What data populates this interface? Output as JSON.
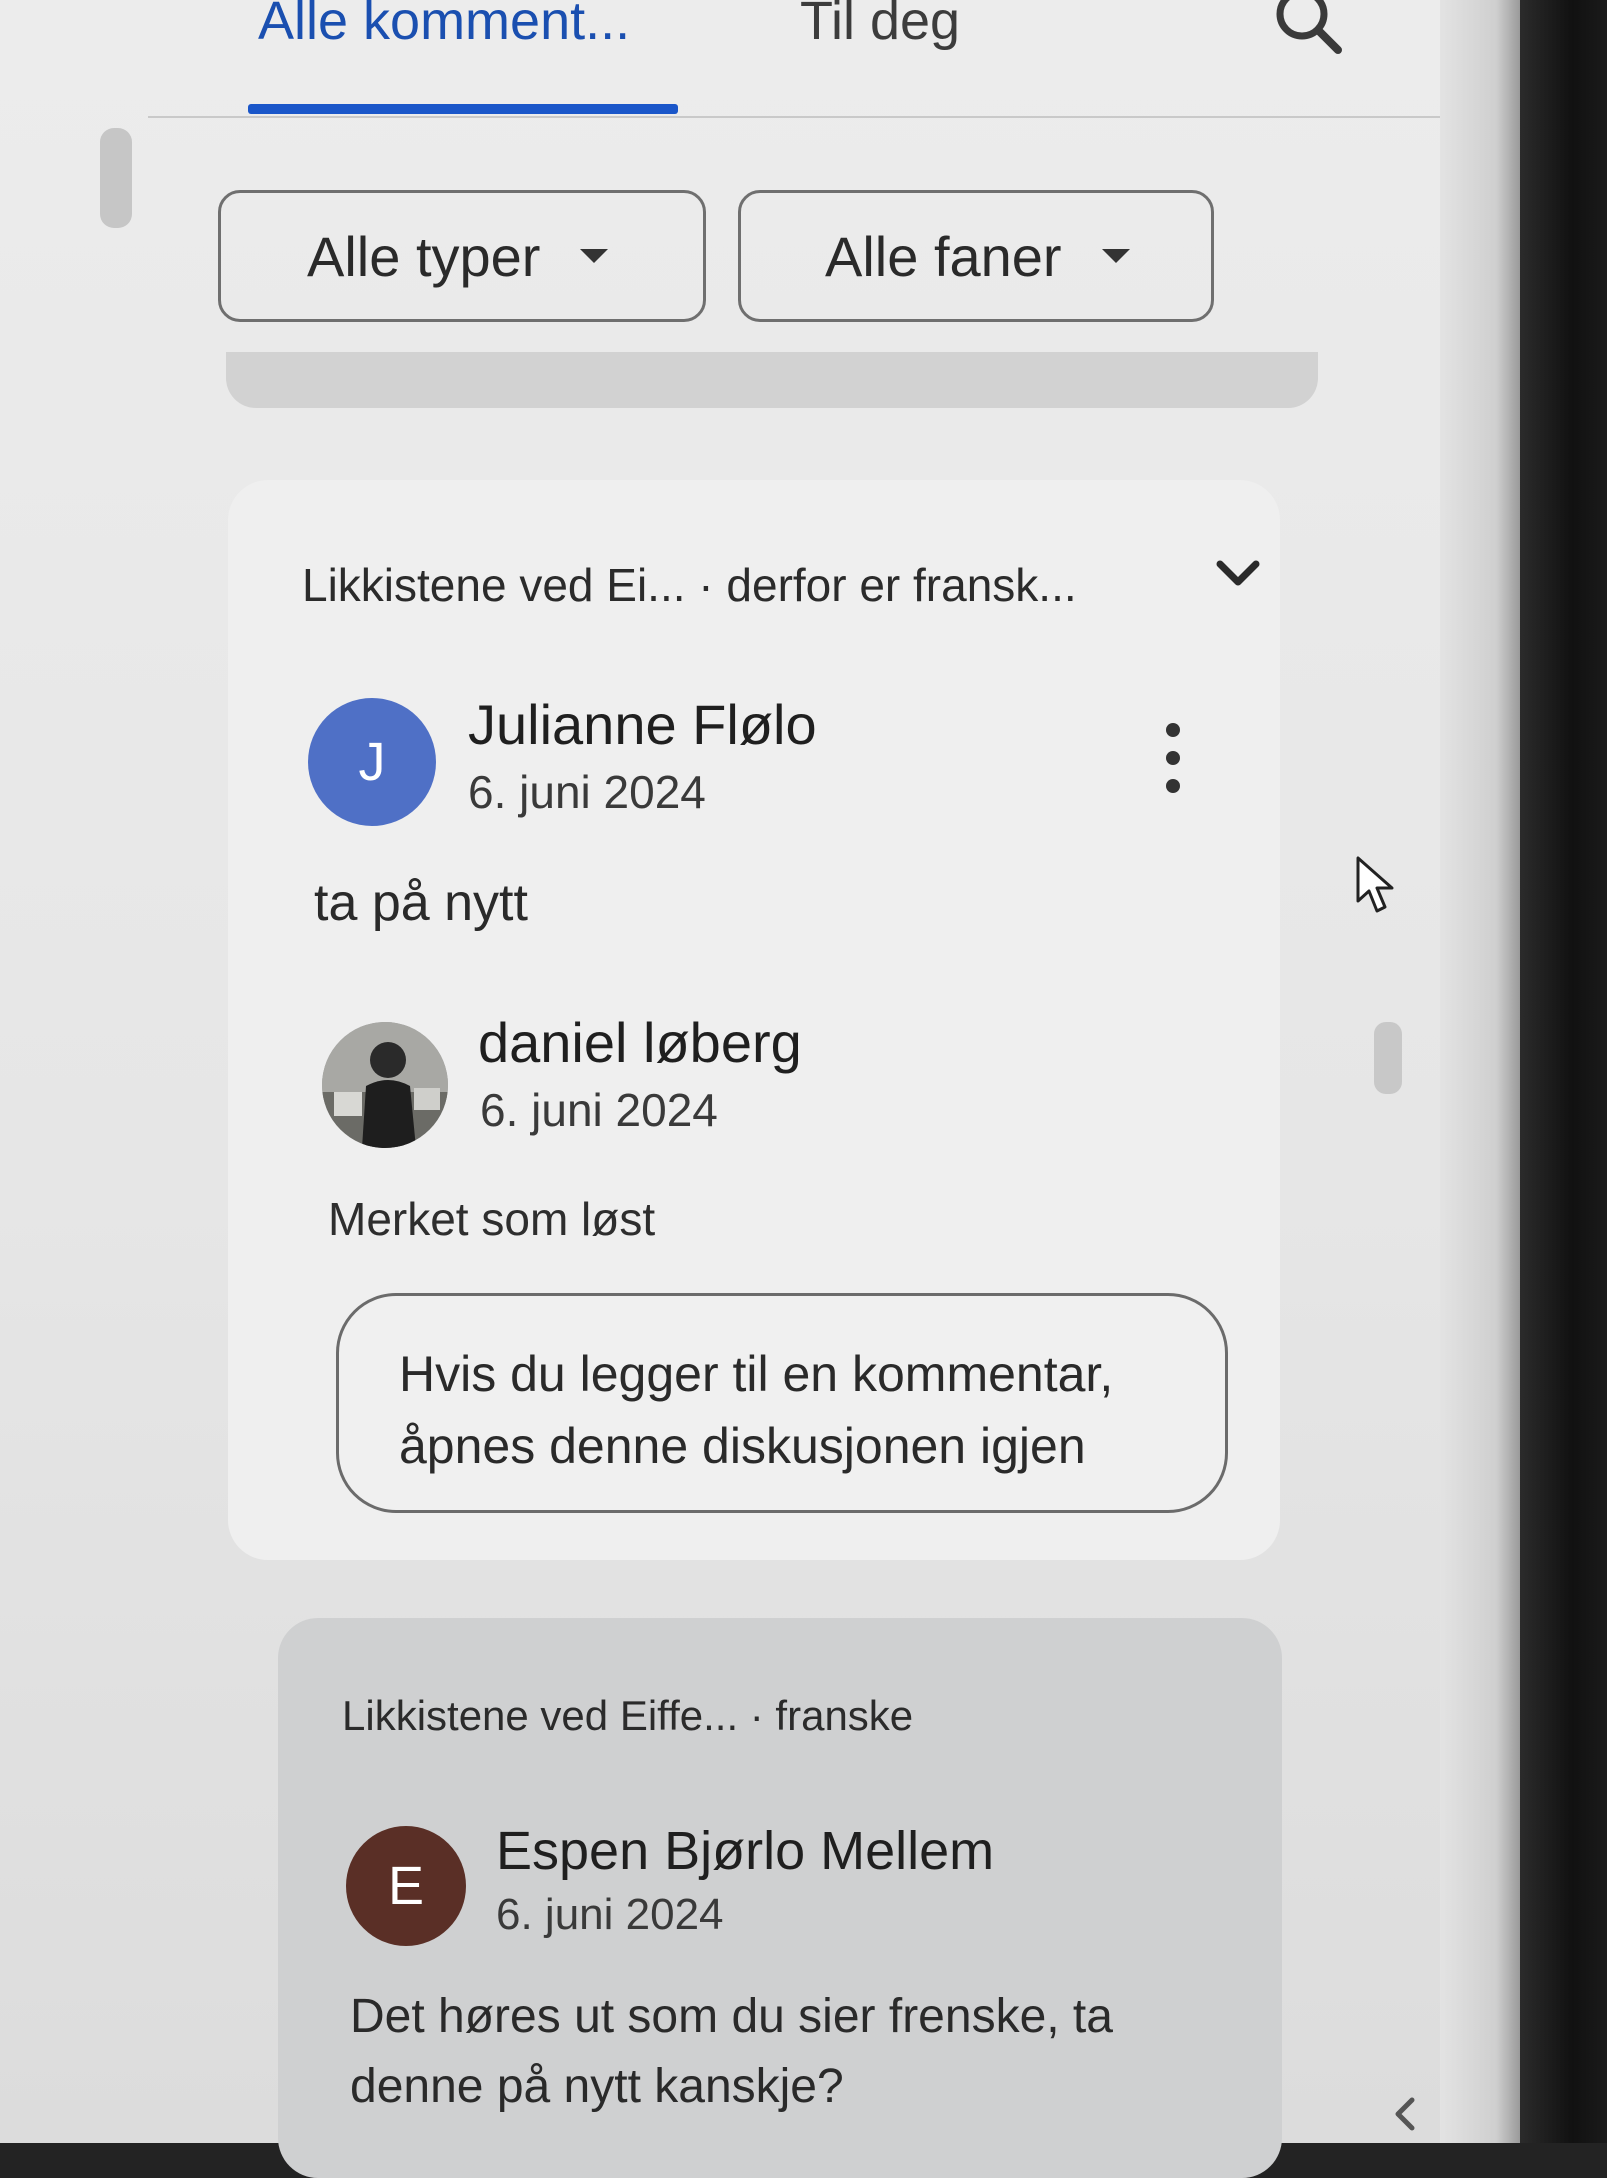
{
  "tabs": [
    {
      "label": "Alle komment...",
      "active": true
    },
    {
      "label": "Til deg",
      "active": false
    }
  ],
  "filters": {
    "types": "Alle typer",
    "tabs": "Alle faner"
  },
  "thread1": {
    "title": "Likkistene ved Ei...  · derfor er fransk...",
    "comment1": {
      "avatar_initial": "J",
      "avatar_color": "#4f70c6",
      "author": "Julianne Flølo",
      "date": "6. juni 2024",
      "text": "ta på nytt"
    },
    "comment2": {
      "author": "daniel løberg",
      "date": "6. juni 2024",
      "status": "Merket som løst"
    },
    "reopen_line1": "Hvis du legger til en kommentar,",
    "reopen_line2": "åpnes denne diskusjonen igjen"
  },
  "thread2": {
    "title": "Likkistene ved Eiffe... · franske",
    "comment1": {
      "avatar_initial": "E",
      "avatar_color": "#5a2f26",
      "author": "Espen Bjørlo Mellem",
      "date": "6. juni 2024",
      "text_line1": "Det høres ut som du sier frenske, ta",
      "text_line2": "denne på nytt kanskje?"
    }
  },
  "colors": {
    "accent": "#1a56c9"
  },
  "icons": [
    "search-icon",
    "chevron-down-icon",
    "more-vert-icon",
    "cursor-icon",
    "chevron-left-icon"
  ]
}
